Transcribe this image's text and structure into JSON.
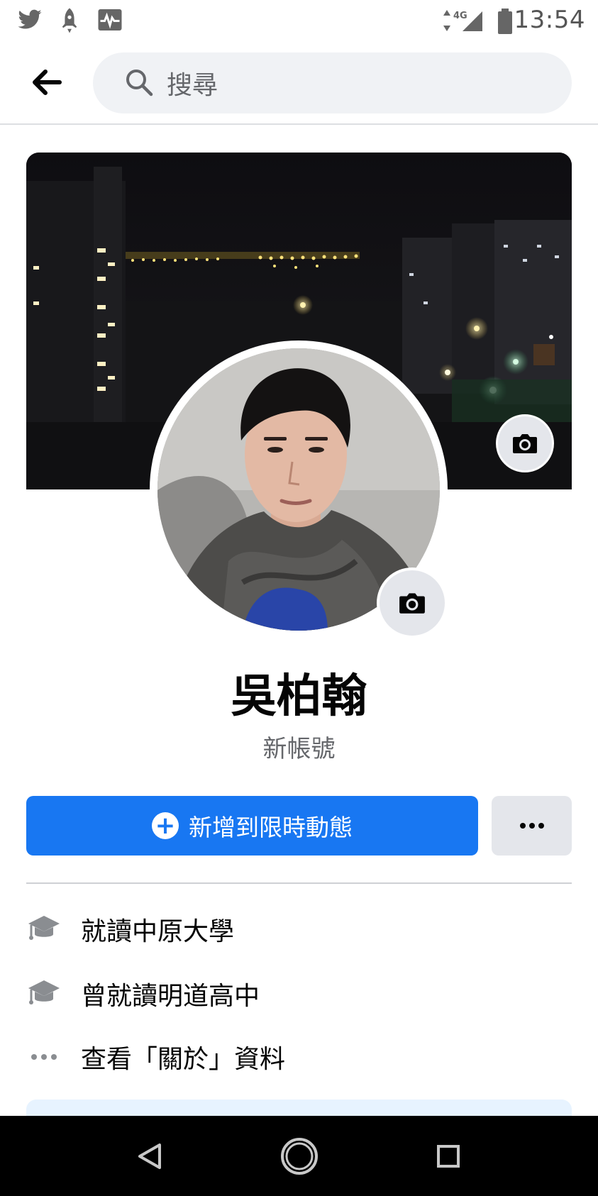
{
  "status_bar": {
    "time": "13:54",
    "network": "4G",
    "icons": [
      "twitter-icon",
      "rocket-icon",
      "activity-icon",
      "signal-icon",
      "battery-icon"
    ]
  },
  "search": {
    "placeholder": "搜尋"
  },
  "profile": {
    "name": "吳柏翰",
    "subtitle": "新帳號"
  },
  "actions": {
    "add_story_label": "新增到限時動態",
    "more_icon": "more-horizontal-icon"
  },
  "details": [
    {
      "icon": "graduation-cap-icon",
      "text": "就讀中原大學"
    },
    {
      "icon": "graduation-cap-icon",
      "text": "曾就讀明道高中"
    },
    {
      "icon": "more-horizontal-icon",
      "text": "查看「關於」資料"
    }
  ],
  "colors": {
    "brand_blue": "#1877f2",
    "secondary_button": "#e4e6eb",
    "search_bg": "#f0f2f5",
    "muted_text": "#65676b"
  }
}
